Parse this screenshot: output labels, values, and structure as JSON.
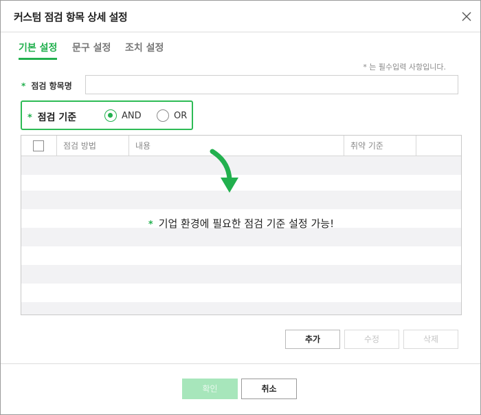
{
  "dialog": {
    "title": "커스텀 점검 항목 상세 설정"
  },
  "tabs": [
    {
      "label": "기본 설정",
      "active": true
    },
    {
      "label": "문구 설정",
      "active": false
    },
    {
      "label": "조치 설정",
      "active": false
    }
  ],
  "required_note": "* 는 필수입력 사항입니다.",
  "form": {
    "required_mark": "*",
    "item_name_label": "점검 항목명",
    "item_name_value": "",
    "criteria_label": "점검 기준",
    "criteria_options": [
      {
        "label": "AND",
        "checked": true
      },
      {
        "label": "OR",
        "checked": false
      }
    ]
  },
  "grid": {
    "columns": [
      "점검 방법",
      "내용",
      "취약 기준",
      ""
    ],
    "rows": []
  },
  "hint": {
    "mark": "*",
    "text": "기업 환경에 필요한 점검 기준 설정 가능!"
  },
  "buttons": {
    "add": "추가",
    "edit": "수정",
    "delete": "삭제",
    "ok": "확인",
    "cancel": "취소"
  },
  "colors": {
    "accent": "#22b04e",
    "highlight_border": "#2dbb55",
    "stripe": "#f2f2f4"
  }
}
